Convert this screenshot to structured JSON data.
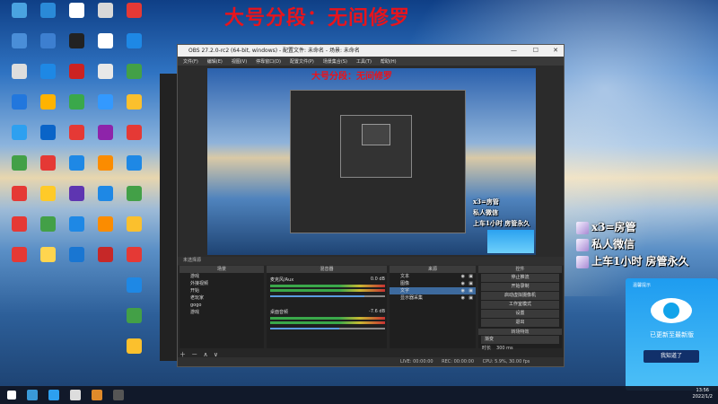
{
  "desktop": {
    "overlay_title": "大号分段：无间修罗",
    "icons": [
      {
        "label": "",
        "color": "#4aa3e0"
      },
      {
        "label": "",
        "color": "#2a8ad8"
      },
      {
        "label": "",
        "color": "#ffffff"
      },
      {
        "label": "",
        "color": "#d8d8d8"
      },
      {
        "label": "",
        "color": "#4a8ed8"
      },
      {
        "label": "",
        "color": "#3d7fd0"
      },
      {
        "label": "",
        "color": "#222222"
      },
      {
        "label": "",
        "color": "#ffffff"
      },
      {
        "label": "",
        "color": "#dddddd"
      },
      {
        "label": "",
        "color": "#1e88e5"
      },
      {
        "label": "",
        "color": "#cc2222"
      },
      {
        "label": "",
        "color": "#e8e8e8"
      },
      {
        "label": "",
        "color": "#2277dd"
      },
      {
        "label": "",
        "color": "#ffb300"
      },
      {
        "label": "",
        "color": "#3aa84a"
      },
      {
        "label": "",
        "color": "#3399ff"
      },
      {
        "label": "",
        "color": "#2da0f0"
      },
      {
        "label": "",
        "color": "#0a64c8"
      },
      {
        "label": "",
        "color": "#e53935"
      },
      {
        "label": "",
        "color": "#8e24aa"
      },
      {
        "label": "",
        "color": "#43a047"
      },
      {
        "label": "",
        "color": "#e53935"
      },
      {
        "label": "",
        "color": "#1e88e5"
      },
      {
        "label": "",
        "color": "#fb8c00"
      },
      {
        "label": "",
        "color": "#e53935"
      },
      {
        "label": "",
        "color": "#ffca28"
      },
      {
        "label": "",
        "color": "#5e35b1"
      },
      {
        "label": "",
        "color": "#1e88e5"
      },
      {
        "label": "",
        "color": "#e53935"
      },
      {
        "label": "",
        "color": "#43a047"
      },
      {
        "label": "",
        "color": "#1e88e5"
      },
      {
        "label": "",
        "color": "#fb8c00"
      },
      {
        "label": "",
        "color": "#e53935"
      },
      {
        "label": "",
        "color": "#ffd54f"
      },
      {
        "label": "",
        "color": "#1976d2"
      },
      {
        "label": "",
        "color": "#c62828"
      }
    ]
  },
  "obs": {
    "window_title": "OBS 27.2.0-rc2 (64-bit, windows) - 配置文件: 未命名 - 场景: 未命名",
    "menu": [
      "文件(F)",
      "编辑(E)",
      "视图(V)",
      "停靠窗口(D)",
      "配置文件(P)",
      "场景集合(S)",
      "工具(T)",
      "帮助(H)"
    ],
    "preview_overlay_title": "大号分段：无间修罗",
    "scene_label": "未选择源",
    "docks": {
      "scenes": {
        "header": "场景",
        "items": [
          "游戏",
          "外接视频",
          "开始",
          "老玩家",
          "gogo",
          "游戏"
        ]
      },
      "mixer": {
        "header": "混音器",
        "tracks": [
          {
            "name": "麦克风/Aux",
            "db": "0.0 dB",
            "volume": 0.82
          },
          {
            "name": "桌面音频",
            "db": "-7.6 dB",
            "volume": 0.6
          }
        ]
      },
      "sources": {
        "header": "来源",
        "items": [
          "文本",
          "图像",
          "文字",
          "显示器采集"
        ],
        "selected": 2
      },
      "controls": {
        "header": "控件",
        "buttons": [
          "停止推流",
          "开始录制",
          "启动虚拟摄像机",
          "工作室模式",
          "设置",
          "退出"
        ],
        "transition_header": "转场特效",
        "transition_value": "渐变",
        "duration_label": "时长",
        "duration_value": "300 ms"
      }
    },
    "status": {
      "live": "LIVE: 00:00:00",
      "rec": "REC: 00:00:00",
      "cpu": "CPU: 5.9%, 30.00 fps"
    }
  },
  "chat": [
    {
      "text": "x3=房管"
    },
    {
      "text": "私人微信"
    },
    {
      "text": "上车1小时  房管永久"
    }
  ],
  "popup": {
    "header": "温馨提示",
    "tagline": "已更新至最新版",
    "button": "我知道了"
  },
  "taskbar": {
    "time": "13:56",
    "date": "2022/1/2"
  }
}
